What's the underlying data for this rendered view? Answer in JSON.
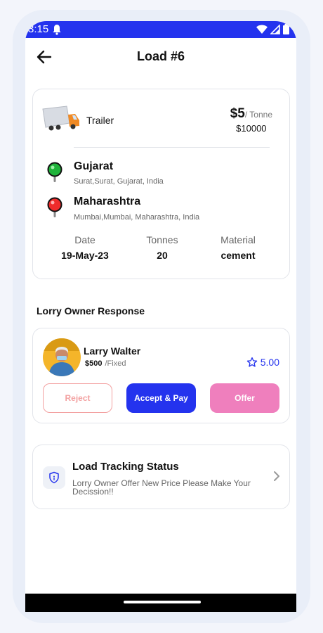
{
  "status_bar": {
    "time": "3:15"
  },
  "header": {
    "title": "Load #6"
  },
  "load": {
    "truck_type": "Trailer",
    "price": "$5",
    "price_unit": "/ Tonne",
    "total": "$10000",
    "origin": {
      "name": "Gujarat",
      "address": "Surat,Surat, Gujarat, India"
    },
    "destination": {
      "name": "Maharashtra",
      "address": "Mumbai,Mumbai, Maharashtra, India"
    },
    "stats": [
      {
        "label": "Date",
        "value": "19-May-23"
      },
      {
        "label": "Tonnes",
        "value": "20"
      },
      {
        "label": "Material",
        "value": "cement"
      }
    ]
  },
  "response_section": {
    "title": "Lorry Owner Response"
  },
  "owner": {
    "name": "Larry Walter",
    "amount": "$500",
    "amount_type": "/Fixed",
    "rating": "5.00"
  },
  "actions": {
    "reject": "Reject",
    "accept": "Accept & Pay",
    "offer": "Offer"
  },
  "tracking": {
    "title": "Load Tracking Status",
    "description": "Lorry Owner Offer New Price Please Make Your Decission!!"
  },
  "colors": {
    "primary": "#2433ee",
    "reject": "#f3a1a1",
    "offer": "#ef7fbd",
    "origin_pin": "#22c55e",
    "destination_pin": "#ef2b2b"
  }
}
